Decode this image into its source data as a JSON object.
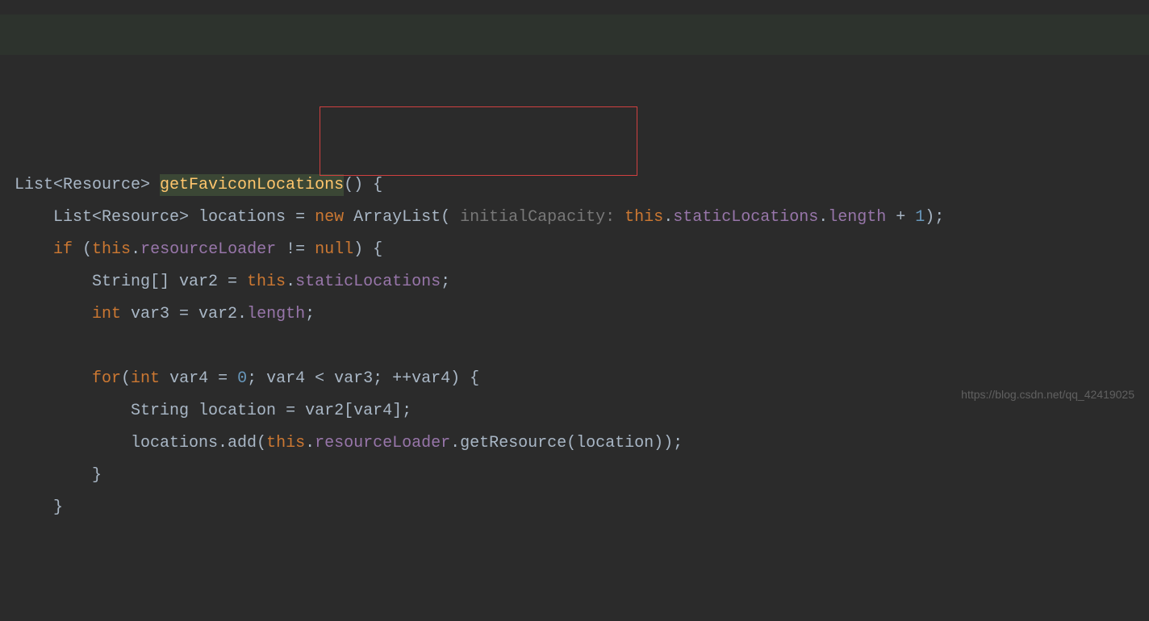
{
  "code": {
    "line1": {
      "p1": "List<Resource> ",
      "method": "getFaviconLocations",
      "p2": "() {"
    },
    "line2": {
      "indent": "    ",
      "p1": "List<Resource> locations = ",
      "kw_new": "new",
      "p2": " ArrayList( ",
      "hint": "initialCapacity: ",
      "kw_this": "this",
      "p3": ".",
      "field": "staticLocations",
      "p4": ".",
      "prop": "length",
      "p5": " + ",
      "num": "1",
      "p6": ");"
    },
    "line3": {
      "indent": "    ",
      "kw_if": "if",
      "p1": " (",
      "kw_this": "this",
      "p2": ".",
      "field": "resourceLoader",
      "p3": " != ",
      "kw_null": "null",
      "p4": ") {"
    },
    "line4": {
      "indent": "        ",
      "p1": "String[] var2 = ",
      "kw_this": "this",
      "p2": ".",
      "field": "staticLocations",
      "p3": ";"
    },
    "line5": {
      "indent": "        ",
      "kw_int": "int",
      "p1": " var3 = var2.",
      "prop": "length",
      "p2": ";"
    },
    "line6": {
      "indent": "        ",
      "kw_for": "for",
      "p1": "(",
      "kw_int": "int",
      "p2": " var4 = ",
      "num": "0",
      "p3": "; var4 < var3; ++var4) {"
    },
    "line7": {
      "indent": "            ",
      "p1": "String location = var2[var4];"
    },
    "line8": {
      "indent": "            ",
      "p1": "locations.add(",
      "kw_this": "this",
      "p2": ".",
      "field": "resourceLoader",
      "p3": ".getResource(location));"
    },
    "line9": {
      "indent": "        ",
      "p1": "}"
    },
    "line10": {
      "indent": "    ",
      "p1": "}"
    }
  },
  "watermark": "https://blog.csdn.net/qq_42419025"
}
